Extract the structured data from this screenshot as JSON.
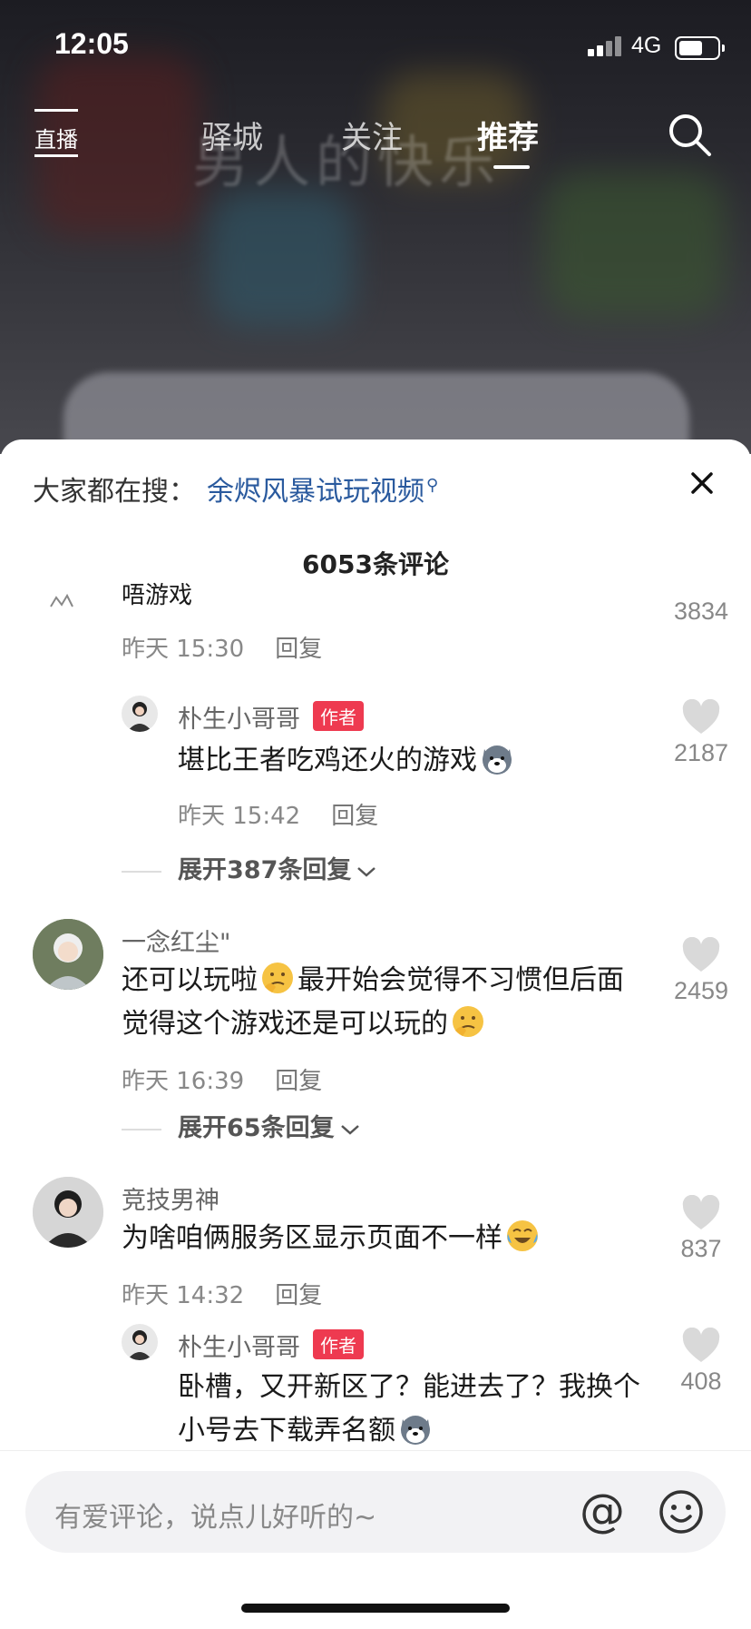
{
  "status_bar": {
    "time": "12:05",
    "network": "4G",
    "battery_level": 0.7
  },
  "background": {
    "video_title": "男人的快乐"
  },
  "top_nav": {
    "live_label": "直播",
    "tabs": [
      {
        "label": "驿城",
        "active": false
      },
      {
        "label": "关注",
        "active": false
      },
      {
        "label": "推荐",
        "active": true
      }
    ]
  },
  "hot_search": {
    "prefix": "大家都在搜：",
    "term": "余烬风暴试玩视频"
  },
  "comment_count_label": "6053条评论",
  "comments": [
    {
      "text": "唔游戏",
      "time": "昨天 15:30",
      "reply_label": "回复",
      "likes": "3834"
    },
    {
      "username": "朴生小哥哥",
      "author_tag": "作者",
      "text": "堪比王者吃鸡还火的游戏",
      "time": "昨天 15:42",
      "reply_label": "回复",
      "likes": "2187"
    },
    {
      "expand_label": "展开387条回复"
    },
    {
      "username": "一念红尘\"",
      "text_part1": "还可以玩啦",
      "text_part2": "最开始会觉得不习惯但后面觉得这个游戏还是可以玩的",
      "time": "昨天 16:39",
      "reply_label": "回复",
      "likes": "2459"
    },
    {
      "expand_label": "展开65条回复"
    },
    {
      "username": "竞技男神",
      "text": "为啥咱俩服务区显示页面不一样",
      "time": "昨天 14:32",
      "reply_label": "回复",
      "likes": "837"
    },
    {
      "username": "朴生小哥哥",
      "author_tag": "作者",
      "text": "卧槽，又开新区了？能进去了？我换个小号去下载弄名额",
      "likes": "408"
    }
  ],
  "input_bar": {
    "placeholder": "有爱评论，说点儿好听的~",
    "at_symbol": "@"
  },
  "colors": {
    "author_tag": "#ee3a50",
    "hot_search_term": "#2a5a9e"
  }
}
